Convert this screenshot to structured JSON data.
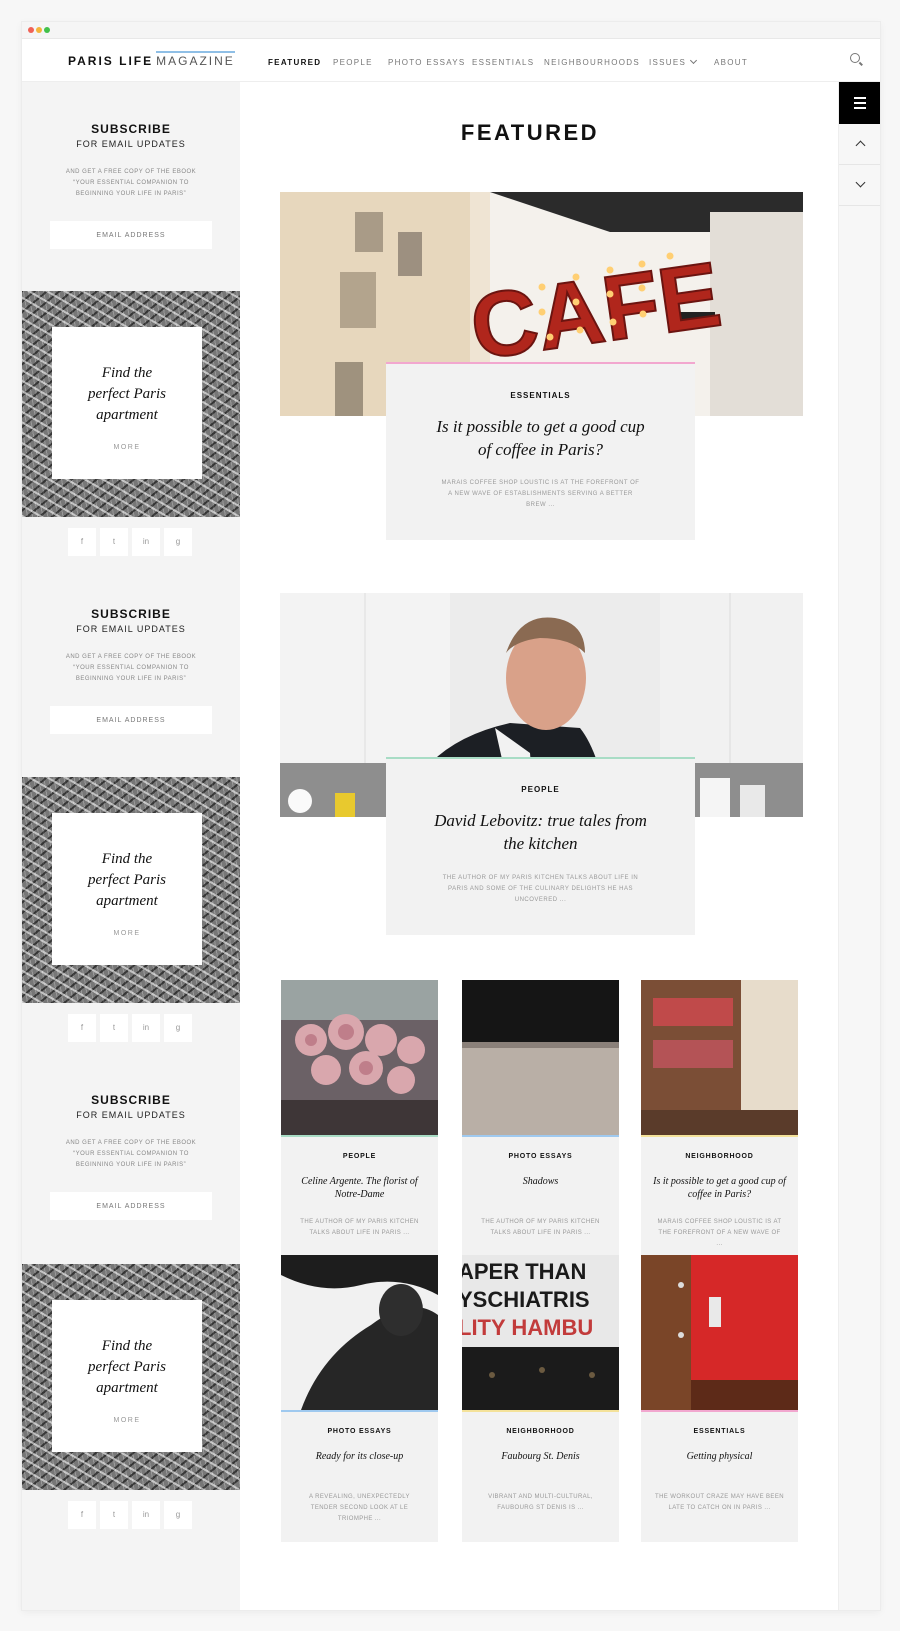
{
  "brand": {
    "name": "PARIS LIFE",
    "sub": "MAGAZINE"
  },
  "nav": {
    "items": [
      "FEATURED",
      "PEOPLE",
      "PHOTO ESSAYS",
      "ESSENTIALS",
      "NEIGHBOURHOODS",
      "ISSUES",
      "ABOUT"
    ],
    "active": "FEATURED"
  },
  "page": {
    "heading": "FEATURED"
  },
  "sidebar": {
    "subscribe": {
      "title": "SUBSCRIBE",
      "subtitle": "FOR EMAIL UPDATES",
      "description": "AND GET A FREE COPY OF THE EBOOK “YOUR ESSENTIAL COMPANION TO BEGINNING YOUR LIFE IN PARIS”",
      "email_placeholder": "EMAIL ADDRESS"
    },
    "promo": {
      "title": "Find the\nperfect Paris\napartment",
      "more": "MORE"
    },
    "social": [
      "f",
      "t",
      "in",
      "g"
    ]
  },
  "featured": [
    {
      "category": "ESSENTIALS",
      "title": "Is it possible to get a good cup of coffee in Paris?",
      "description": "MARAIS COFFEE SHOP LOUSTIC IS AT THE FOREFRONT OF A NEW WAVE OF ESTABLISHMENTS SERVING A BETTER BREW ...",
      "accent": "#f2a7cf"
    },
    {
      "category": "PEOPLE",
      "title": "David Lebovitz: true tales from the kitchen",
      "description": "THE AUTHOR OF MY PARIS KITCHEN TALKS ABOUT LIFE IN PARIS AND SOME OF THE CULINARY DELIGHTS HE HAS UNCOVERED ...",
      "accent": "#a8dcc5"
    }
  ],
  "grid": [
    {
      "category": "PEOPLE",
      "title": "Celine Argente. The florist of Notre-Dame",
      "description": "THE AUTHOR OF MY PARIS KITCHEN TALKS ABOUT LIFE IN PARIS ...",
      "accent": "#a8dcc5"
    },
    {
      "category": "PHOTO ESSAYS",
      "title": "Shadows",
      "description": "THE AUTHOR OF MY PARIS KITCHEN TALKS ABOUT LIFE IN PARIS ...",
      "accent": "#9fc9ef"
    },
    {
      "category": "NEIGHBORHOOD",
      "title": "Is it possible to get a good cup of coffee in Paris?",
      "description": "MARAIS COFFEE SHOP LOUSTIC IS AT THE FOREFRONT OF A NEW WAVE OF ...",
      "accent": "#f4e29a"
    },
    {
      "category": "PHOTO ESSAYS",
      "title": "Ready for its close-up",
      "description": "A REVEALING, UNEXPECTEDLY TENDER SECOND LOOK AT LE TRIOMPHE ...",
      "accent": "#9fc9ef"
    },
    {
      "category": "NEIGHBORHOOD",
      "title": "Faubourg St. Denis",
      "description": "VIBRANT AND MULTI-CULTURAL, FAUBOURG ST DENIS IS ...",
      "accent": "#f4e29a"
    },
    {
      "category": "ESSENTIALS",
      "title": "Getting physical",
      "description": "THE WORKOUT CRAZE MAY HAVE BEEN LATE TO CATCH ON IN PARIS ...",
      "accent": "#f2a7cf"
    }
  ],
  "images": {
    "cafe_sign": "CAFE",
    "theatre_sign": [
      "APER THAN",
      "YSCHIATRIS",
      "LITY HAMBU"
    ]
  }
}
